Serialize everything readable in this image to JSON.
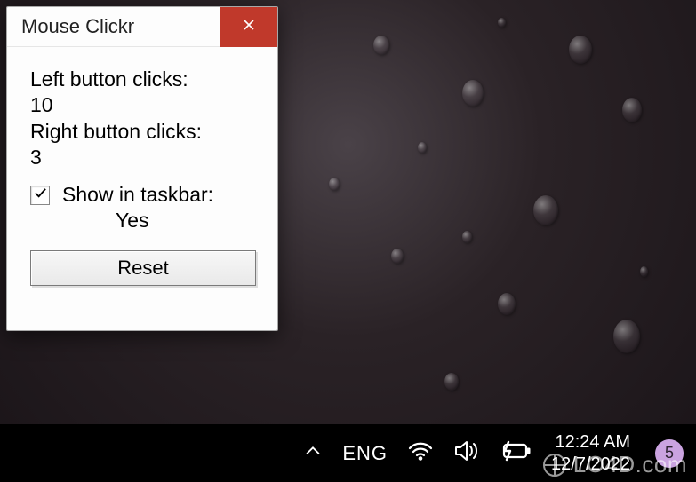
{
  "window": {
    "title": "Mouse Clickr",
    "left_label": "Left button clicks:",
    "left_count": "10",
    "right_label": "Right button clicks:",
    "right_count": "3",
    "show_in_taskbar_label": "Show in taskbar:",
    "show_in_taskbar_value": "Yes",
    "show_in_taskbar_checked": true,
    "reset_label": "Reset"
  },
  "taskbar": {
    "language": "ENG",
    "time": "12:24 AM",
    "date": "12/7/2022",
    "notification_count": "5"
  },
  "watermark": {
    "text": "LO4D.com"
  }
}
